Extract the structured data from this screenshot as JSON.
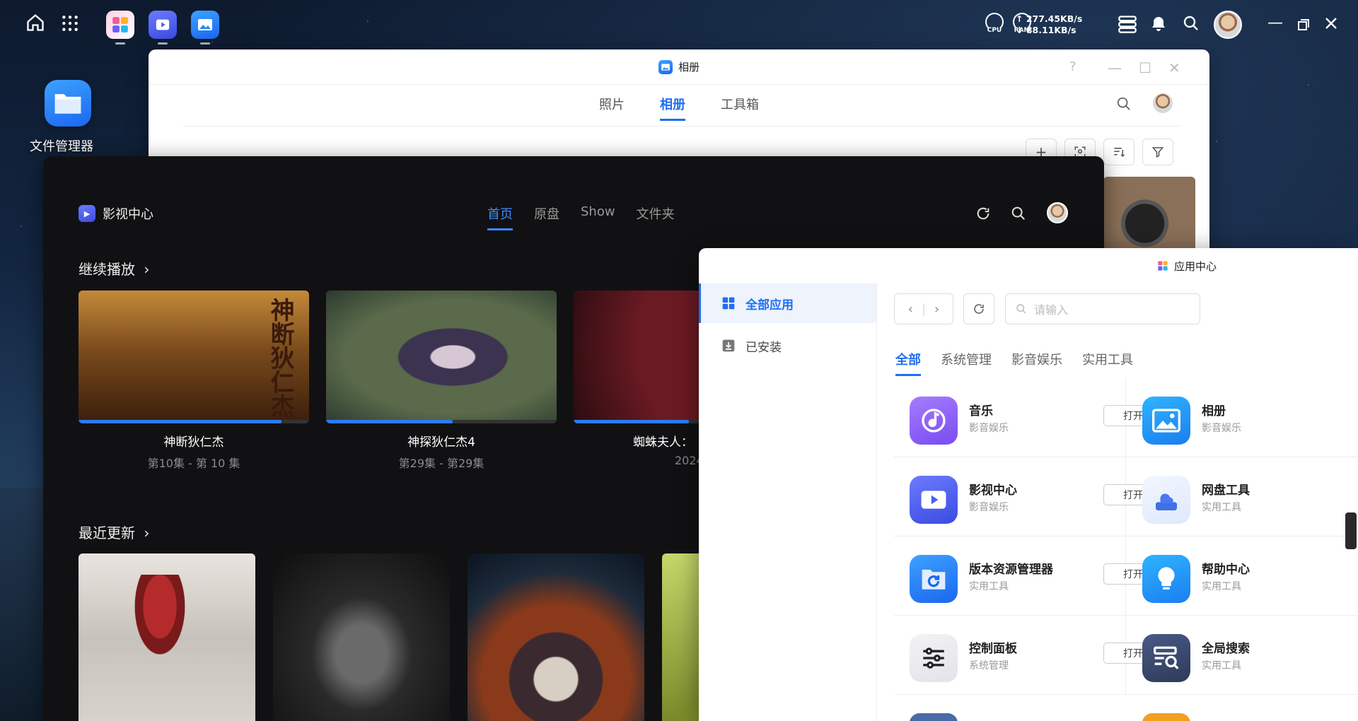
{
  "topbar": {
    "home_icon": "home-icon",
    "grid_icon": "grid-icon",
    "cpu_label": "CPU",
    "ram_label": "RAM",
    "upload": "↑ 277.45KB/s",
    "download": "↓ 88.11KB/s"
  },
  "desktop": {
    "file_manager_label": "文件管理器"
  },
  "album": {
    "title": "相册",
    "tabs": [
      "照片",
      "相册",
      "工具箱"
    ],
    "active_tab": 1,
    "help": "?"
  },
  "video": {
    "brand": "影视中心",
    "nav": [
      "首页",
      "原盘",
      "Show",
      "文件夹"
    ],
    "continue_title": "继续播放",
    "recent_title": "最近更新",
    "continue_items": [
      {
        "title": "神断狄仁杰",
        "episode": "第10集 - 第 10 集",
        "progress": 0.88
      },
      {
        "title": "神探狄仁杰4",
        "episode": "第29集 - 第29集",
        "progress": 0.55
      },
      {
        "title": "蜘蛛夫人：",
        "episode": "2024",
        "progress": 0.5
      }
    ]
  },
  "appcenter": {
    "title": "应用中心",
    "sidebar": [
      {
        "label": "全部应用",
        "icon": "grid-icon",
        "active": true
      },
      {
        "label": "已安装",
        "icon": "download-icon",
        "active": false
      }
    ],
    "search_placeholder": "请输入",
    "categories": [
      "全部",
      "系统管理",
      "影音娱乐",
      "实用工具"
    ],
    "open_label": "打开",
    "apps": [
      {
        "name": "音乐",
        "category": "影音娱乐",
        "icon": "music-icon",
        "color": "#8a5cf6"
      },
      {
        "name": "相册",
        "category": "影音娱乐",
        "icon": "image-icon",
        "color": "#1e8ef2"
      },
      {
        "name": "影视中心",
        "category": "影音娱乐",
        "icon": "video-icon",
        "color": "#4a5ef0"
      },
      {
        "name": "网盘工具",
        "category": "实用工具",
        "icon": "cloud-drive-icon",
        "color": "#4a78ee"
      },
      {
        "name": "版本资源管理器",
        "category": "实用工具",
        "icon": "restore-icon",
        "color": "#1a80f0"
      },
      {
        "name": "帮助中心",
        "category": "实用工具",
        "icon": "lightbulb-icon",
        "color": "#1e90f2"
      },
      {
        "name": "控制面板",
        "category": "系统管理",
        "icon": "sliders-icon",
        "color": "#e8e8ec"
      },
      {
        "name": "全局搜索",
        "category": "实用工具",
        "icon": "search-list-icon",
        "color": "#3d4a6e"
      }
    ]
  }
}
